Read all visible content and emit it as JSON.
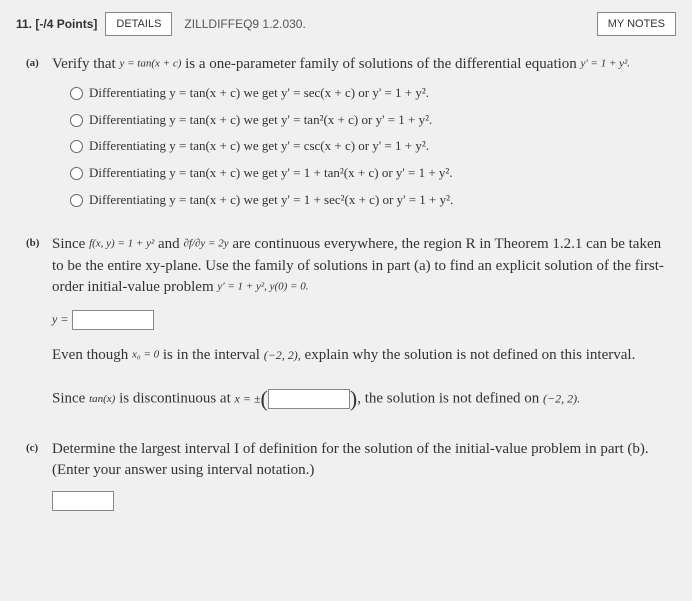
{
  "header": {
    "question_number": "11.",
    "points": "[-/4 Points]",
    "details_label": "DETAILS",
    "source": "ZILLDIFFEQ9 1.2.030.",
    "notes_label": "MY NOTES"
  },
  "part_a": {
    "label": "(a)",
    "text_1": "Verify that ",
    "eq_1": "y = tan(x + c)",
    "text_2": " is a one-parameter family of solutions of the differential equation ",
    "eq_2": "y' = 1 + y².",
    "options": [
      "Differentiating y = tan(x + c) we get y' = sec(x + c) or y' = 1 + y².",
      "Differentiating y = tan(x + c) we get y' = tan²(x + c) or y' = 1 + y².",
      "Differentiating y = tan(x + c) we get y' = csc(x + c) or y' = 1 + y².",
      "Differentiating y = tan(x + c) we get y' = 1 + tan²(x + c) or y' = 1 + y².",
      "Differentiating y = tan(x + c) we get y' = 1 + sec²(x + c) or y' = 1 + y²."
    ]
  },
  "part_b": {
    "label": "(b)",
    "text_1": "Since ",
    "eq_f": "f(x, y) = 1 + y²",
    "text_2": " and ",
    "eq_df": "∂f/∂y = 2y",
    "text_3": " are continuous everywhere, the region R in Theorem 1.2.1 can be taken to be the entire xy-plane. Use the family of solutions in part (a) to find an explicit solution of the first-order initial-value problem ",
    "eq_ivp": "y' = 1 + y²,  y(0) = 0.",
    "y_equals": "y =",
    "text_4": "Even though ",
    "eq_x0": "x₀ = 0",
    "text_5": " is in the interval ",
    "interval_1": "(−2, 2),",
    "text_6": " explain why the solution is not defined on this interval.",
    "text_7": "Since ",
    "eq_tan": "tan(x)",
    "text_8": " is discontinuous at ",
    "eq_xpm_pre": "x = ±",
    "text_9": " the solution is not defined on ",
    "interval_2": "(−2, 2)."
  },
  "part_c": {
    "label": "(c)",
    "text": "Determine the largest interval I of definition for the solution of the initial-value problem in part (b). (Enter your answer using interval notation.)"
  }
}
